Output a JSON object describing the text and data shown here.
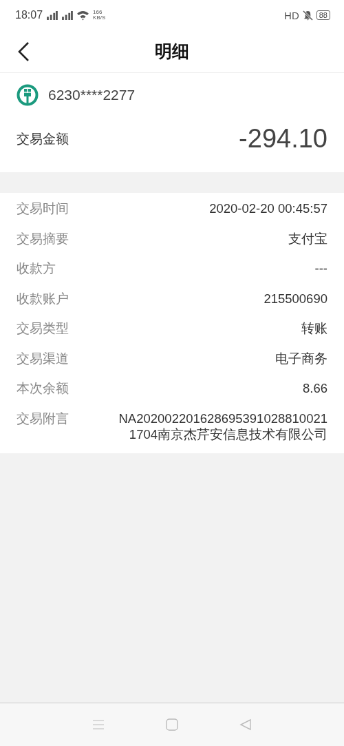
{
  "status_bar": {
    "time": "18:07",
    "network_speed": "166",
    "speed_unit": "KB/S",
    "hd_label": "HD",
    "battery": "88"
  },
  "header": {
    "title": "明细"
  },
  "account": {
    "card_number": "6230****2277",
    "amount_label": "交易金额",
    "amount": "-294.10"
  },
  "details": [
    {
      "label": "交易时间",
      "value": "2020-02-20 00:45:57"
    },
    {
      "label": "交易摘要",
      "value": "支付宝"
    },
    {
      "label": "收款方",
      "value": "---"
    },
    {
      "label": "收款账户",
      "value": "215500690"
    },
    {
      "label": "交易类型",
      "value": "转账"
    },
    {
      "label": "交易渠道",
      "value": "电子商务"
    },
    {
      "label": "本次余额",
      "value": "8.66"
    },
    {
      "label": "交易附言",
      "value": "NA2020022016286953910288100211704南京杰芹安信息技术有限公司"
    }
  ]
}
